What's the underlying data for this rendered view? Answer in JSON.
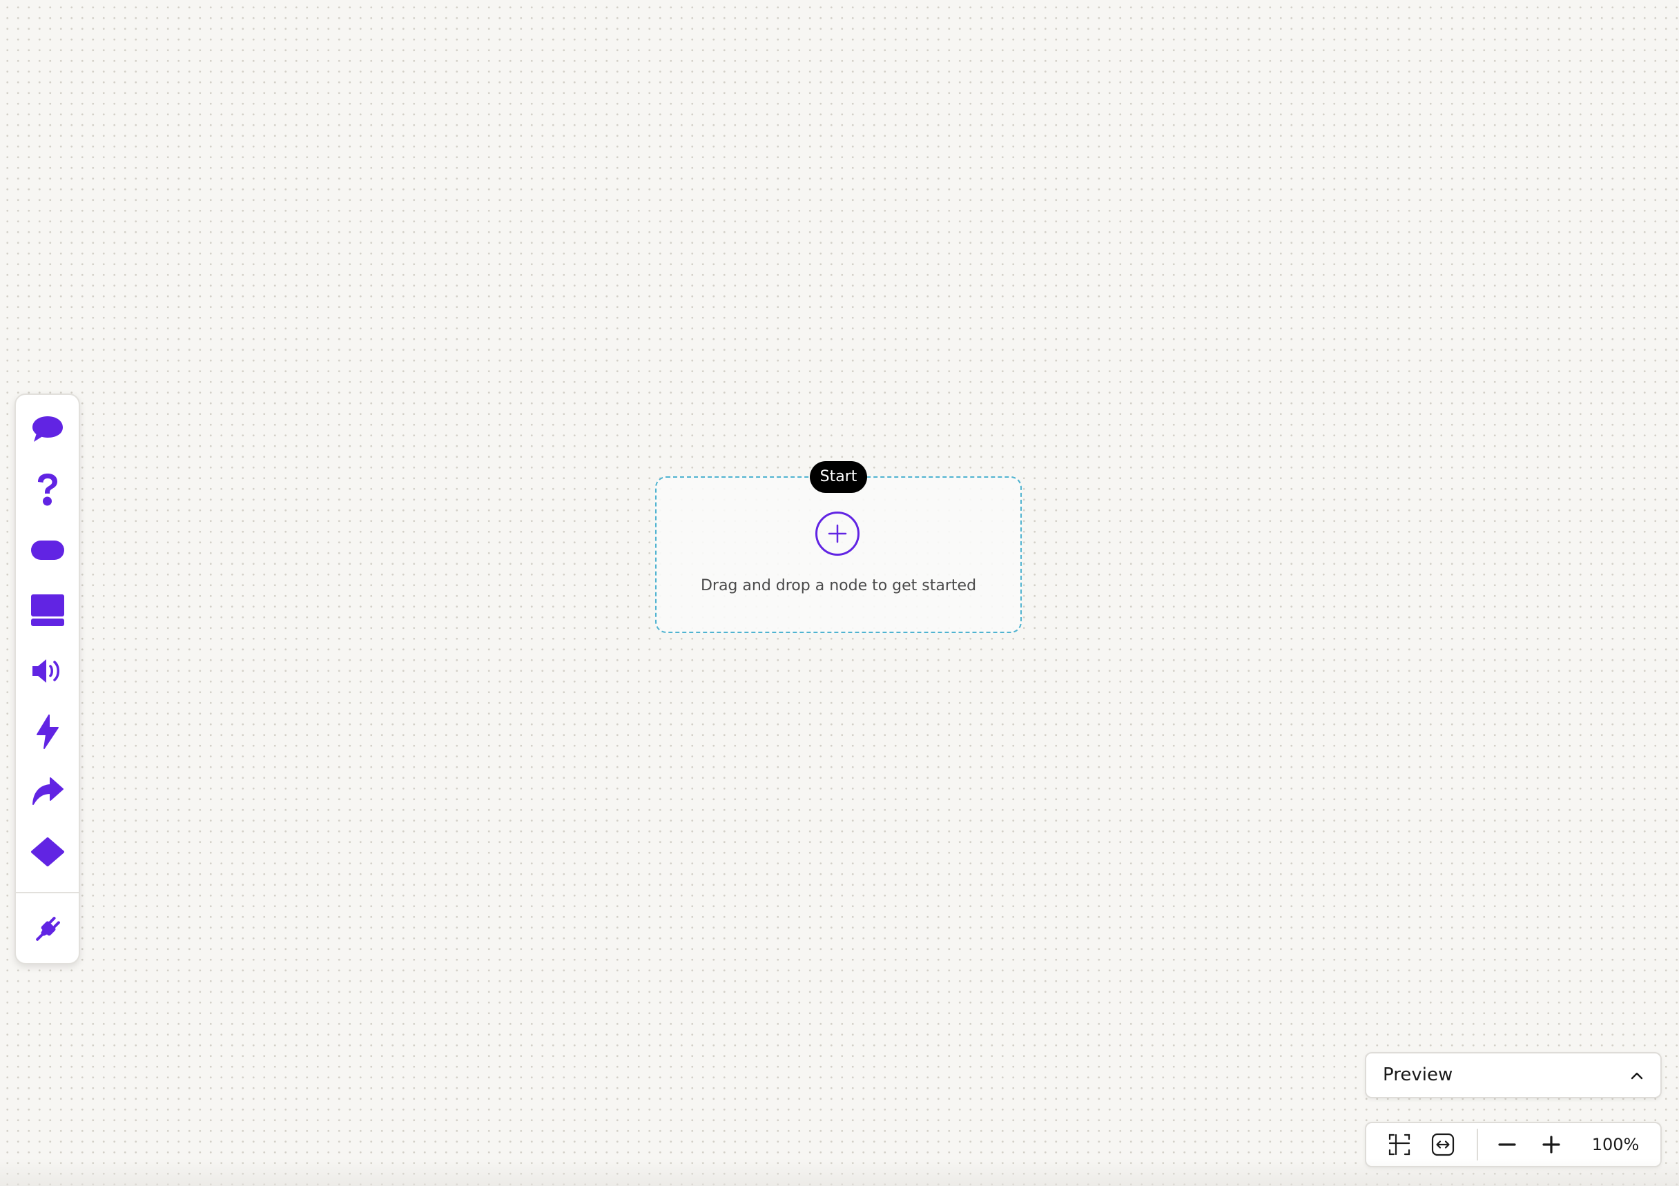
{
  "colors": {
    "accent": "#6124e3",
    "canvas_background": "#f7f6f3",
    "start_node_border": "#4fb3d0",
    "start_pill_background": "#000000"
  },
  "toolbar": {
    "items": [
      {
        "name": "message",
        "icon": "speech-bubble-icon"
      },
      {
        "name": "question",
        "icon": "question-mark-icon"
      },
      {
        "name": "button",
        "icon": "pill-button-icon"
      },
      {
        "name": "card",
        "icon": "card-layout-icon"
      },
      {
        "name": "audio",
        "icon": "speaker-icon"
      },
      {
        "name": "action",
        "icon": "lightning-bolt-icon"
      },
      {
        "name": "redirect",
        "icon": "share-arrow-icon"
      },
      {
        "name": "condition",
        "icon": "diamond-icon"
      }
    ],
    "integration": {
      "name": "integrations",
      "icon": "plug-icon"
    }
  },
  "start_node": {
    "label": "Start",
    "hint": "Drag and drop a node to get started",
    "add_icon": "plus-circle-icon"
  },
  "preview": {
    "label": "Preview",
    "icon": "chevron-up-icon"
  },
  "zoom_controls": {
    "fit_icon": "fit-selection-icon",
    "fit_width_icon": "fit-width-icon",
    "zoom_out_icon": "minus-icon",
    "zoom_in_icon": "plus-icon",
    "zoom_level": "100%"
  }
}
